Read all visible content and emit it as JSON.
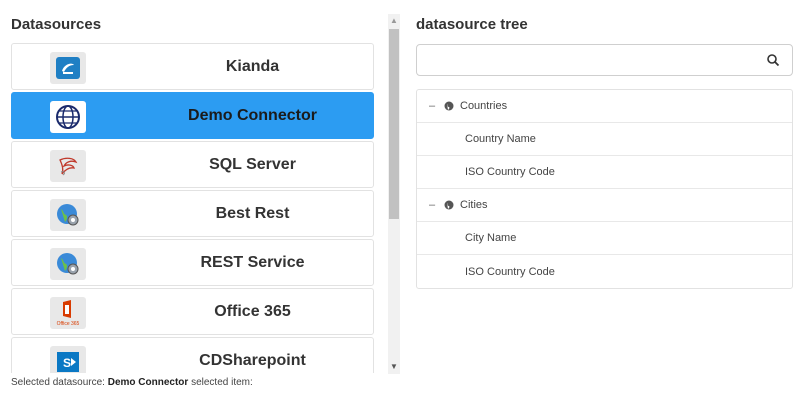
{
  "datasources": {
    "title": "Datasources",
    "items": [
      {
        "label": "Kianda",
        "icon": "kianda-logo-icon",
        "selected": false
      },
      {
        "label": "Demo Connector",
        "icon": "globe-wireframe-icon",
        "selected": true
      },
      {
        "label": "SQL Server",
        "icon": "sql-server-icon",
        "selected": false
      },
      {
        "label": "Best Rest",
        "icon": "globe-gear-icon",
        "selected": false
      },
      {
        "label": "REST Service",
        "icon": "globe-gear-icon",
        "selected": false
      },
      {
        "label": "Office 365",
        "icon": "office-365-icon",
        "icon_text": "Office 365",
        "selected": false
      },
      {
        "label": "CDSharepoint",
        "icon": "sharepoint-icon",
        "selected": false
      }
    ]
  },
  "tree": {
    "title": "datasource tree",
    "search_value": "",
    "search_placeholder": "",
    "nodes": [
      {
        "label": "Countries",
        "toggle": "–",
        "children": [
          "Country Name",
          "ISO Country Code"
        ]
      },
      {
        "label": "Cities",
        "toggle": "–",
        "children": [
          "City Name",
          "ISO Country Code"
        ]
      }
    ]
  },
  "status": {
    "prefix": "Selected datasource:",
    "datasource": "Demo Connector",
    "suffix": "selected item:"
  },
  "colors": {
    "selected": "#2c9cf2",
    "kianda": "#1f7fc4",
    "sql": "#c0392b",
    "office": "#d83b01",
    "sharepoint": "#0a78c4"
  }
}
